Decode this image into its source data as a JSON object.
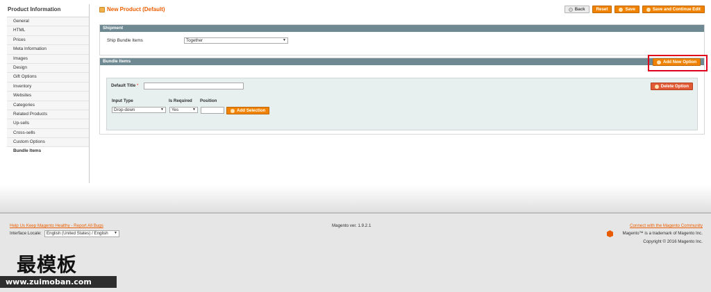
{
  "sidebar": {
    "title": "Product Information",
    "items": [
      {
        "label": "General"
      },
      {
        "label": "HTML"
      },
      {
        "label": "Prices"
      },
      {
        "label": "Meta Information"
      },
      {
        "label": "Images"
      },
      {
        "label": "Design"
      },
      {
        "label": "Gift Options"
      },
      {
        "label": "Inventory"
      },
      {
        "label": "Websites"
      },
      {
        "label": "Categories"
      },
      {
        "label": "Related Products"
      },
      {
        "label": "Up-sells"
      },
      {
        "label": "Cross-sells"
      },
      {
        "label": "Custom Options"
      },
      {
        "label": "Bundle Items",
        "active": true
      }
    ]
  },
  "header": {
    "title": "New Product (Default)",
    "title_icon": "product-icon",
    "buttons": {
      "back": "Back",
      "reset": "Reset",
      "save": "Save",
      "save_continue": "Save and Continue Edit"
    }
  },
  "shipment": {
    "title": "Shipment",
    "ship_label": "Ship Bundle Items",
    "ship_value": "Together"
  },
  "bundle": {
    "title": "Bundle Items",
    "add_option": "Add New Option",
    "default_title_label": "Default Title",
    "required_mark": "*",
    "delete_option": "Delete Option",
    "input_type_label": "Input Type",
    "input_type_value": "Drop-down",
    "is_required_label": "Is Required",
    "is_required_value": "Yes",
    "position_label": "Position",
    "add_selection": "Add Selection"
  },
  "footer": {
    "help_link": "Help Us Keep Magento Healthy - Report All Bugs",
    "locale_label": "Interface Locale:",
    "locale_value": "English (United States) / English",
    "version": "Magento ver. 1.9.2.1",
    "community_link": "Connect with the Magento Community",
    "trademark": "Magento™ is a trademark of Magento Inc.",
    "copyright": "Copyright © 2016 Magento Inc."
  },
  "watermark": {
    "brand": "最模板",
    "url": "www.zuimoban.com"
  },
  "colors": {
    "accent": "#eb5e00",
    "button_orange": "#f18200",
    "section_header": "#6f8992",
    "highlight": "#e0001b"
  }
}
